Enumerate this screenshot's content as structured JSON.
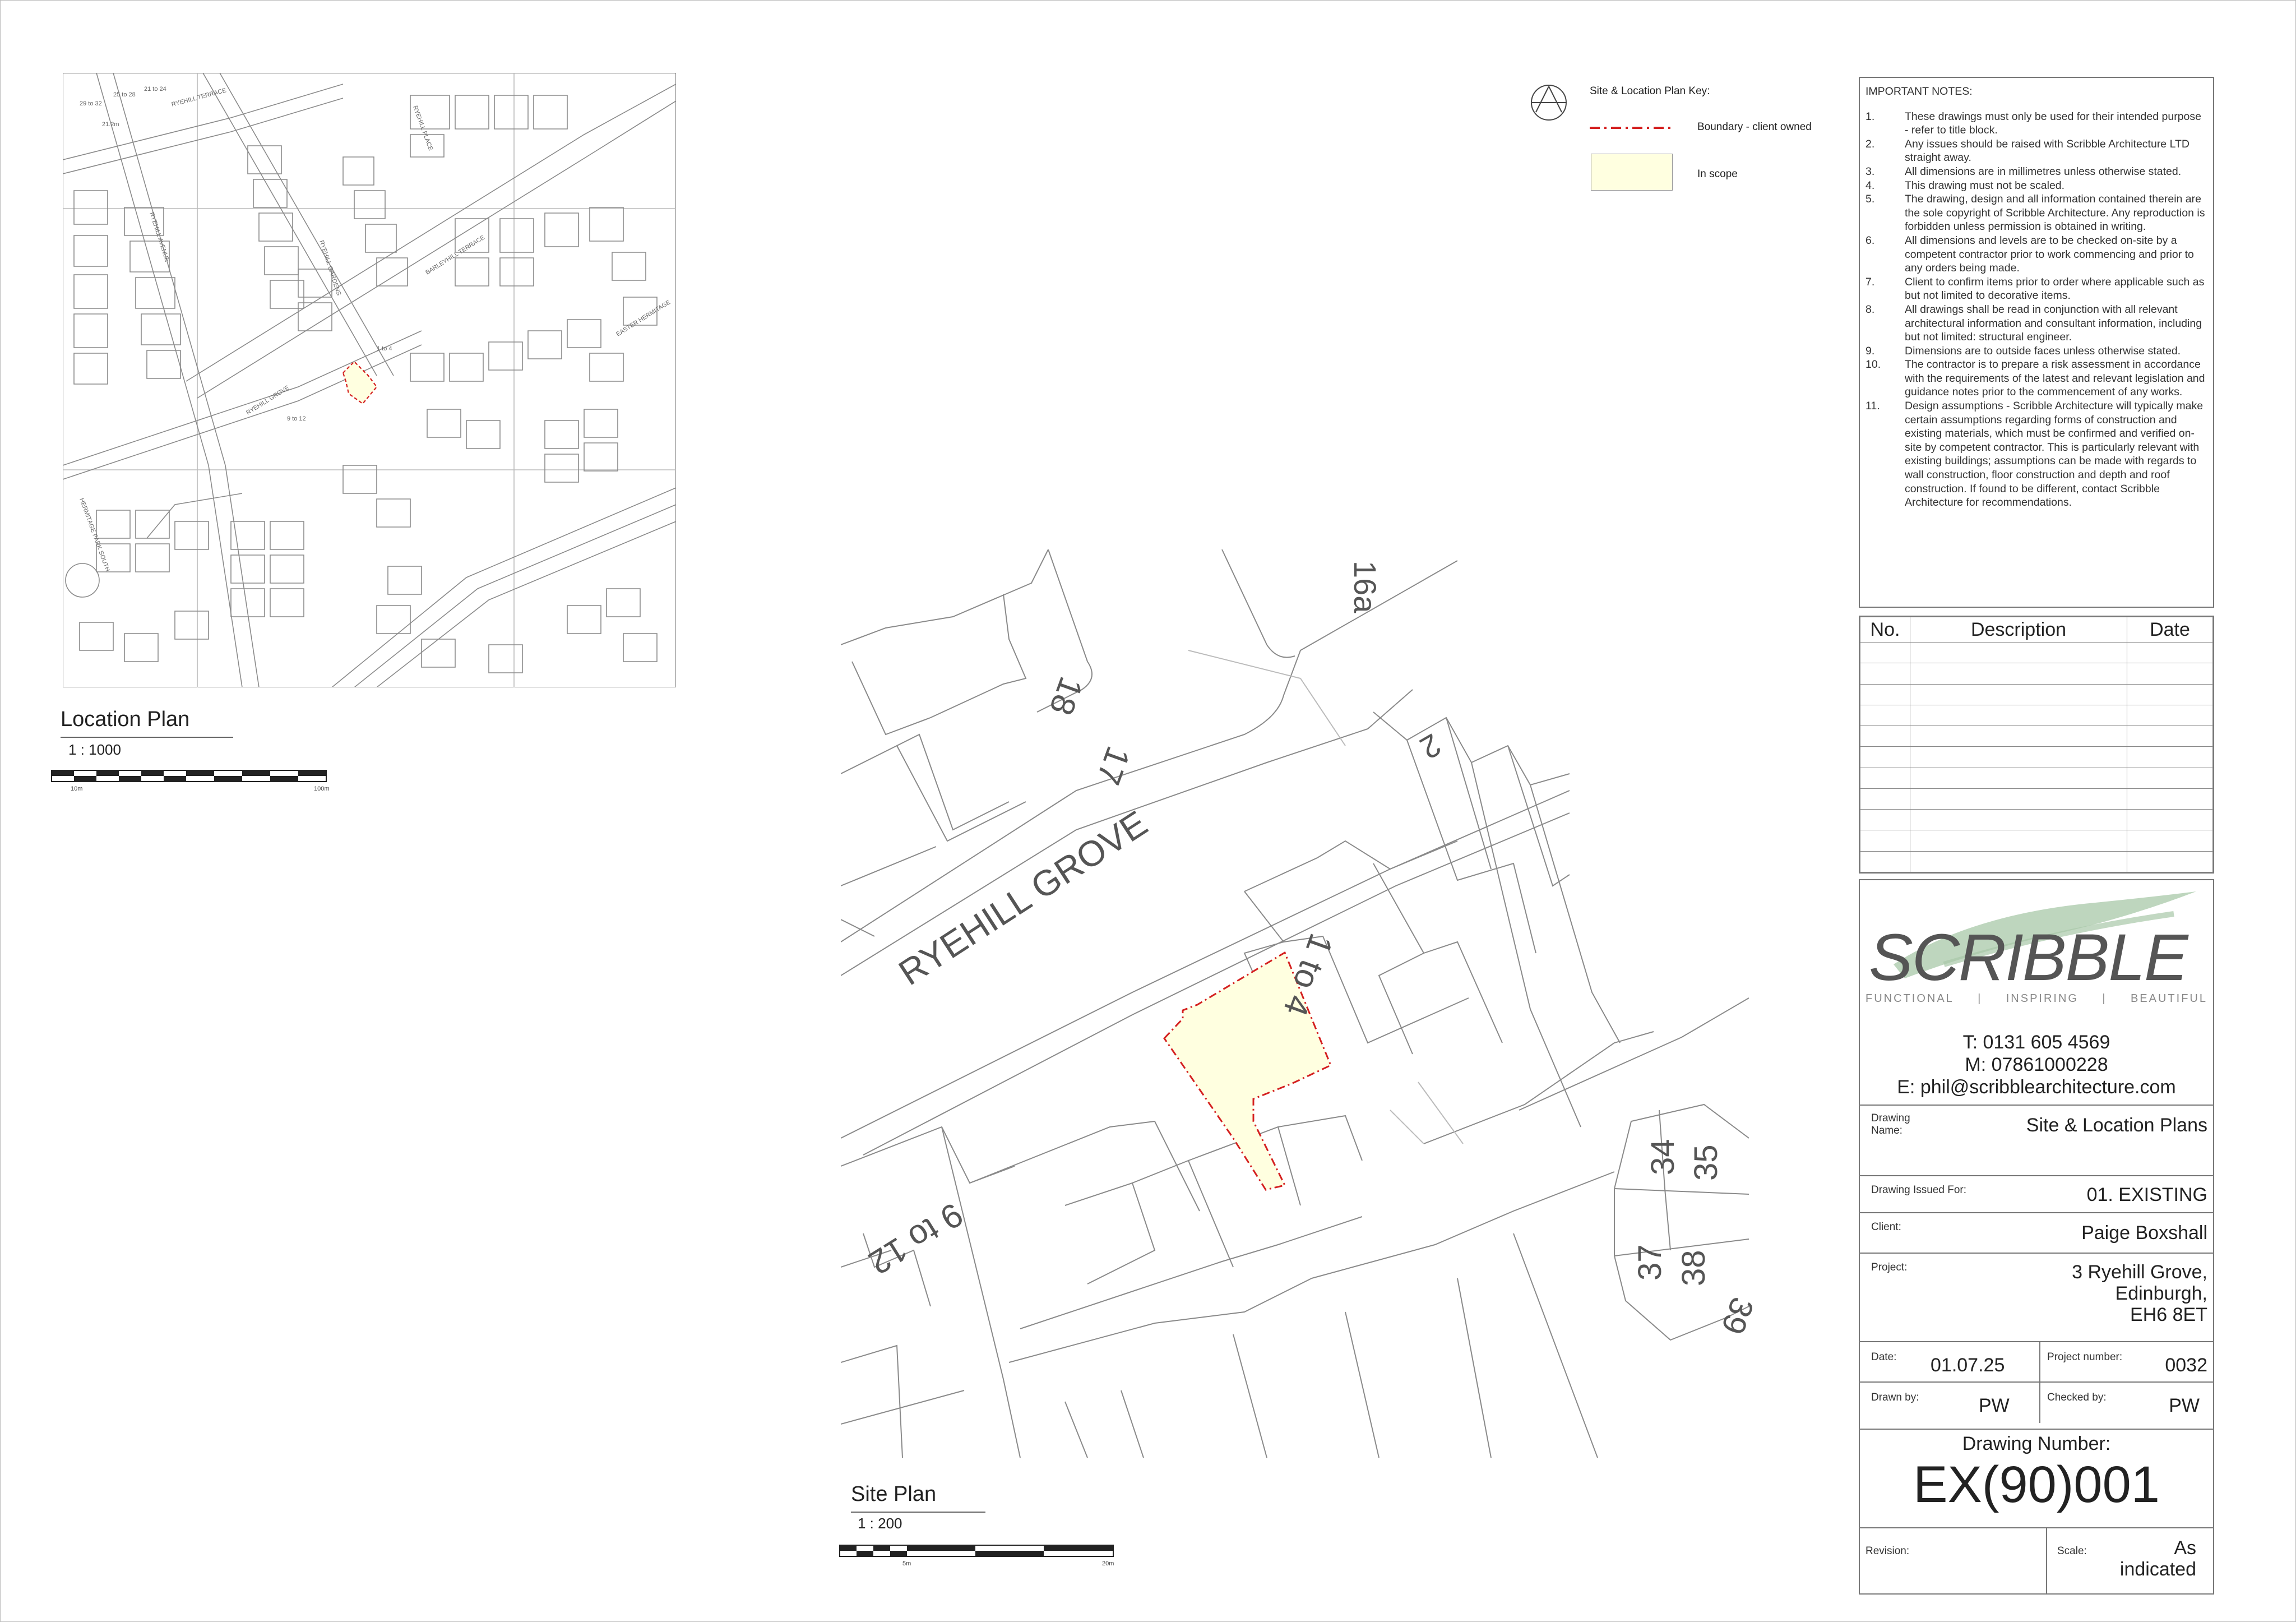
{
  "key": {
    "title": "Site & Location Plan Key:",
    "items": [
      {
        "label": "Boundary - client owned",
        "color": "#d42020"
      },
      {
        "label": "In scope",
        "color": "#ffffe0"
      }
    ]
  },
  "location_plan": {
    "title": "Location Plan",
    "scale": "1 : 1000",
    "scalebar": {
      "left_label": "10m",
      "right_label": "100m"
    },
    "labels": {
      "streets": [
        "RYEHILL TERRACE",
        "RYEHILL PLACE",
        "RYEHILL AVENUE",
        "RYEHILL GARDENS",
        "BARLEYHILL TERRACE",
        "RYEHILL GROVE",
        "EASTER HERMITAGE",
        "HERMITAGE PARK SOUTH"
      ],
      "numbers": [
        "29 to 32",
        "25 to 28",
        "21 to 24",
        "8 to 1",
        "1 to 4",
        "9 to 12",
        "13",
        "25",
        "35",
        "21",
        "22 to 25",
        "39",
        "70",
        "80",
        "92",
        "98",
        "21.2m"
      ]
    }
  },
  "site_plan": {
    "title": "Site Plan",
    "scale": "1 : 200",
    "scalebar": {
      "left_label": "5m",
      "right_label": "20m"
    },
    "labels": {
      "street": "RYEHILL GROVE",
      "plot_1to4": "1 to 4",
      "plot_9to12": "9 to 12",
      "plot_16a": "16a",
      "plot_18": "18",
      "plot_17": "17",
      "plot_2": "2",
      "plot_34": "34",
      "plot_35": "35",
      "plot_37": "37",
      "plot_38": "38",
      "plot_39": "39"
    }
  },
  "notes": {
    "heading": "IMPORTANT NOTES:",
    "items": [
      {
        "n": "1.",
        "text": "These drawings must only be used for their intended purpose - refer to title block."
      },
      {
        "n": "2.",
        "text": "Any issues should be raised with Scribble Architecture LTD straight away."
      },
      {
        "n": "3.",
        "text": "All dimensions are in millimetres unless otherwise stated."
      },
      {
        "n": "4.",
        "text": "This drawing must not be scaled."
      },
      {
        "n": "5.",
        "text": "The drawing, design and all information contained therein are the sole copyright of Scribble Architecture. Any reproduction is forbidden unless permission is obtained in writing."
      },
      {
        "n": "6.",
        "text": "All dimensions and levels are to be checked on-site by a competent contractor prior to work commencing and prior to any orders being made."
      },
      {
        "n": "7.",
        "text": "Client to confirm items prior to order where applicable such as but not limited to decorative items."
      },
      {
        "n": "8.",
        "text": "All drawings shall be read in conjunction with all relevant architectural information and consultant information, including but not limited: structural engineer."
      },
      {
        "n": "9.",
        "text": "Dimensions are to outside faces unless otherwise stated."
      },
      {
        "n": "10.",
        "text": "The contractor is to prepare a risk assessment in accordance with the requirements of the latest and relevant legislation and guidance notes prior to the commencement of any works."
      },
      {
        "n": "11.",
        "text": "Design assumptions - Scribble Architecture will typically make certain assumptions regarding forms of construction and existing materials, which must be confirmed and verified on-site by competent contractor. This is particularly relevant with existing buildings; assumptions can be made with regards to wall construction, floor construction and depth and roof construction. If found to be different, contact Scribble Architecture for recommendations."
      }
    ]
  },
  "revisions": {
    "headers": [
      "No.",
      "Description",
      "Date"
    ],
    "empty_rows": 11
  },
  "title_block": {
    "logo_text": "SCRIBBLE",
    "tagline": [
      "FUNCTIONAL",
      "INSPIRING",
      "BEAUTIFUL"
    ],
    "phone": "T: 0131 605 4569",
    "mobile": "M: 07861000228",
    "email": "E: phil@scribblearchitecture.com",
    "drawing_name_label": "Drawing Name:",
    "drawing_name": "Site & Location Plans",
    "issued_for_label": "Drawing Issued For:",
    "issued_for": "01. EXISTING",
    "client_label": "Client:",
    "client": "Paige Boxshall",
    "project_label": "Project:",
    "project": [
      "3 Ryehill Grove,",
      "Edinburgh,",
      "EH6 8ET"
    ],
    "date_label": "Date:",
    "date": "01.07.25",
    "project_number_label": "Project number:",
    "project_number": "0032",
    "drawn_by_label": "Drawn by:",
    "drawn_by": "PW",
    "checked_by_label": "Checked by:",
    "checked_by": "PW",
    "drawing_number_label": "Drawing Number:",
    "drawing_number": "EX(90)001",
    "revision_label": "Revision:",
    "scale_label": "Scale:",
    "scale": [
      "As",
      "indicated"
    ]
  },
  "colors": {
    "boundary": "#d42020",
    "in_scope": "#ffffe0",
    "linework": "#8a8a8a",
    "logo_green": "#a8c8a8"
  }
}
